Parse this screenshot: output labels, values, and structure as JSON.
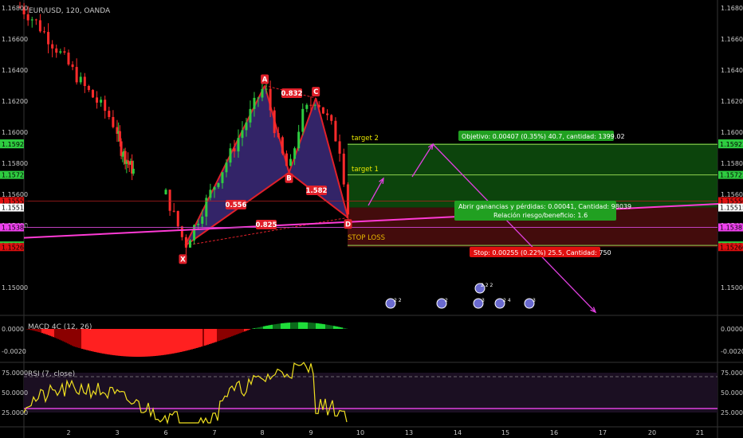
{
  "header": {
    "title": "EUR/USD, 120, OANDA"
  },
  "price_axis": {
    "ticks": [
      {
        "label": "1.16800",
        "v": 1.168
      },
      {
        "label": "1.16600",
        "v": 1.166
      },
      {
        "label": "1.16400",
        "v": 1.164
      },
      {
        "label": "1.16200",
        "v": 1.162
      },
      {
        "label": "1.16000",
        "v": 1.16
      },
      {
        "label": "1.15800",
        "v": 1.158
      },
      {
        "label": "1.15600",
        "v": 1.156
      },
      {
        "label": "1.15400",
        "v": 1.154
      },
      {
        "label": "1.15000",
        "v": 1.15
      }
    ],
    "tags": [
      {
        "label": "1.15928",
        "v": 1.15928,
        "color": "#2ecc40"
      },
      {
        "label": "1.15922",
        "v": 1.15922,
        "color": "#2ecc40"
      },
      {
        "label": "1.15725",
        "v": 1.15725,
        "color": "#2ecc40"
      },
      {
        "label": "1.15556",
        "v": 1.15556,
        "color": "#e01010"
      },
      {
        "label": "1.15515",
        "v": 1.15515,
        "color": "#ffffff"
      },
      {
        "label": "1.15387",
        "v": 1.15387,
        "color": "#ee40ee"
      },
      {
        "label": "1.15271",
        "v": 1.15271,
        "color": "#2ecc40"
      },
      {
        "label": "1.15260",
        "v": 1.1526,
        "color": "#e01010"
      }
    ]
  },
  "time_axis": {
    "labels": [
      "2",
      "3",
      "6",
      "7",
      "8",
      "9",
      "10",
      "13",
      "14",
      "15",
      "16",
      "17",
      "20",
      "21"
    ]
  },
  "pattern": {
    "points": {
      "X": {
        "label": "X",
        "t": 6.4,
        "v": 1.1527
      },
      "A": {
        "label": "A",
        "t": 8.05,
        "v": 1.163
      },
      "B": {
        "label": "B",
        "t": 8.55,
        "v": 1.1574
      },
      "C": {
        "label": "C",
        "t": 9.1,
        "v": 1.1622
      },
      "D": {
        "label": "D",
        "t": 9.75,
        "v": 1.1545
      }
    },
    "ratios": {
      "xb": "0.556",
      "ac": "0.832",
      "bd": "1.582",
      "xd": "0.825"
    }
  },
  "targets": {
    "target1": "target 2",
    "target2": "target 1",
    "stop_loss": "STOP LOSS"
  },
  "position": {
    "objective": "Objetivo: 0.00407 (0.35%) 40.7, cantidad: 1399.02",
    "open_line1": "Abrir ganancias y pérdidas: 0.00041, Cantidad: 98039",
    "open_line2": "Relación riesgo/beneficio: 1.6",
    "stop": "Stop: 0.00255 (0.22%) 25.5, Cantidad: 750"
  },
  "events": [
    {
      "label": "2 2"
    },
    {
      "label": "2"
    },
    {
      "label": "3"
    },
    {
      "label": "2 4"
    },
    {
      "label": "3"
    },
    {
      "label": "2 2 2"
    }
  ],
  "macd": {
    "label": "MACD 4C (12, 26)",
    "ticks": [
      {
        "label": "0.0000",
        "v": 0
      },
      {
        "label": "-0.0020",
        "v": -0.002
      }
    ]
  },
  "rsi": {
    "label": "RSI (7, close)",
    "ticks": [
      {
        "label": "75.0000",
        "v": 75
      },
      {
        "label": "50.0000",
        "v": 50
      },
      {
        "label": "25.0000",
        "v": 25
      }
    ]
  }
}
